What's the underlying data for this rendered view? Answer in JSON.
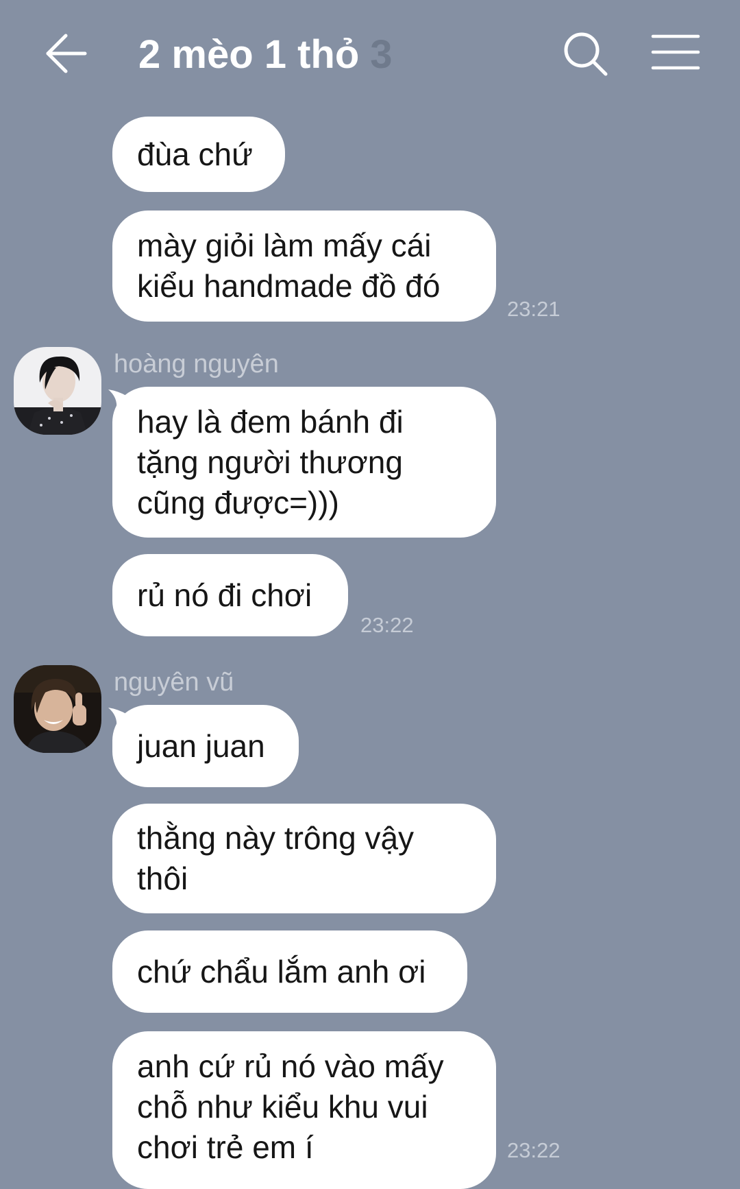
{
  "header": {
    "back_icon": "arrow-left-icon",
    "title": "2 mèo 1 thỏ",
    "member_count": "3",
    "search_icon": "search-icon",
    "menu_icon": "hamburger-menu-icon"
  },
  "messages": {
    "m1": "đùa chứ",
    "m2": "mày giỏi làm mấy cái\nkiểu handmade đồ đó",
    "t1": "23:21",
    "sender1": "hoàng nguyên",
    "m3": "hay là đem bánh đi\ntặng người thương\ncũng được=)))",
    "m4": "rủ nó đi chơi",
    "t2": "23:22",
    "sender2": "nguyên vũ",
    "m5": "juan juan",
    "m6": "thằng này trông vậy\nthôi",
    "m7": "chứ chẩu lắm anh ơi",
    "m8": "anh cứ rủ nó vào mấy\nchỗ như kiểu khu vui\nchơi trẻ em í",
    "t3": "23:22"
  },
  "colors": {
    "background": "#8590a3",
    "bubble": "#ffffff",
    "timestamp": "#c6ccd6"
  }
}
